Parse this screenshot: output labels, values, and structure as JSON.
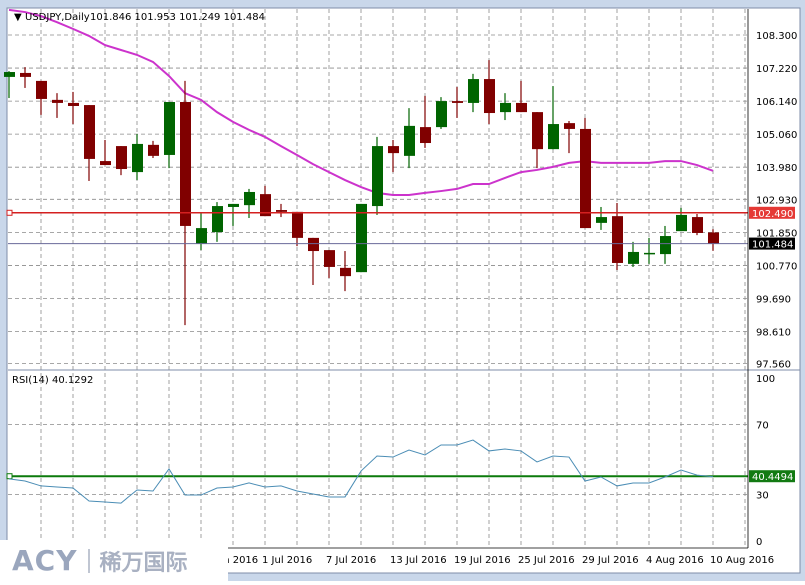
{
  "header": {
    "symbol": "USDJPY,Daily",
    "ohlc": "101.846 101.953 101.249 101.484"
  },
  "rsi_label": "RSI(14) 40.1292",
  "watermark": {
    "brand": "ACY",
    "chinese": "稀万国际"
  },
  "colors": {
    "bull": "#006400",
    "bear": "#800000",
    "ma": "#cc33cc",
    "hline": "#d42020",
    "price_line": "#6a6a9a",
    "rsi": "#4b8db5",
    "rsi_level": "#0b7a0b"
  },
  "chart_data": [
    {
      "type": "candlestick",
      "symbol": "USDJPY",
      "timeframe": "Daily",
      "ylim": [
        97.2,
        108.6
      ],
      "yticks": [
        "108.300",
        "107.220",
        "106.140",
        "105.060",
        "103.980",
        "102.930",
        "101.850",
        "100.770",
        "99.690",
        "98.610",
        "97.560"
      ],
      "grid": true,
      "dates": [
        "9 Jun",
        "10 Jun",
        "13 Jun",
        "14 Jun",
        "15 Jun",
        "16 Jun",
        "17 Jun",
        "20 Jun",
        "21 Jun",
        "22 Jun",
        "23 Jun",
        "24 Jun",
        "27 Jun",
        "28 Jun",
        "29 Jun",
        "30 Jun",
        "1 Jul",
        "4 Jul",
        "5 Jul",
        "6 Jul",
        "7 Jul",
        "8 Jul",
        "11 Jul",
        "12 Jul",
        "13 Jul",
        "14 Jul",
        "15 Jul",
        "18 Jul",
        "19 Jul",
        "20 Jul",
        "21 Jul",
        "22 Jul",
        "25 Jul",
        "26 Jul",
        "27 Jul",
        "28 Jul",
        "29 Jul",
        "1 Aug",
        "2 Aug",
        "3 Aug",
        "4 Aug",
        "5 Aug",
        "8 Aug",
        "9 Aug",
        "10 Aug"
      ],
      "xtick_labels": [
        {
          "index": 12,
          "label": "27 Jun 2016"
        },
        {
          "index": 16,
          "label": "1 Jul 2016"
        },
        {
          "index": 20,
          "label": "7 Jul 2016"
        },
        {
          "index": 24,
          "label": "13 Jul 2016"
        },
        {
          "index": 28,
          "label": "19 Jul 2016"
        },
        {
          "index": 32,
          "label": "25 Jul 2016"
        },
        {
          "index": 36,
          "label": "29 Jul 2016"
        },
        {
          "index": 40,
          "label": "4 Aug 2016"
        },
        {
          "index": 44,
          "label": "10 Aug 2016"
        }
      ],
      "ohlc": [
        [
          106.93,
          107.12,
          106.24,
          107.09
        ],
        [
          107.06,
          107.25,
          106.57,
          106.93
        ],
        [
          106.8,
          106.8,
          105.69,
          106.21
        ],
        [
          106.18,
          106.4,
          105.59,
          106.08
        ],
        [
          106.08,
          106.44,
          105.39,
          105.98
        ],
        [
          106.01,
          106.01,
          103.53,
          104.25
        ],
        [
          104.18,
          104.87,
          104.05,
          104.05
        ],
        [
          104.67,
          104.67,
          103.72,
          103.92
        ],
        [
          103.82,
          105.06,
          103.56,
          104.74
        ],
        [
          104.71,
          104.84,
          104.28,
          104.35
        ],
        [
          104.38,
          106.11,
          103.95,
          106.11
        ],
        [
          106.11,
          106.8,
          98.82,
          102.06
        ],
        [
          101.47,
          102.48,
          101.27,
          101.99
        ],
        [
          101.86,
          102.84,
          101.54,
          102.71
        ],
        [
          102.68,
          102.78,
          102.06,
          102.78
        ],
        [
          102.74,
          103.27,
          102.32,
          103.17
        ],
        [
          103.1,
          103.37,
          102.38,
          102.38
        ],
        [
          102.58,
          102.78,
          102.35,
          102.52
        ],
        [
          102.52,
          102.52,
          101.4,
          101.67
        ],
        [
          101.67,
          101.67,
          100.13,
          101.24
        ],
        [
          101.27,
          101.27,
          100.36,
          100.72
        ],
        [
          100.69,
          101.24,
          99.93,
          100.42
        ],
        [
          100.55,
          102.78,
          100.55,
          102.78
        ],
        [
          102.71,
          104.97,
          102.42,
          104.67
        ],
        [
          104.67,
          104.87,
          103.82,
          104.44
        ],
        [
          104.35,
          105.91,
          103.95,
          105.33
        ],
        [
          105.29,
          106.31,
          104.61,
          104.77
        ],
        [
          105.29,
          106.27,
          105.23,
          106.14
        ],
        [
          106.14,
          106.6,
          105.59,
          106.08
        ],
        [
          106.08,
          107.03,
          105.78,
          106.86
        ],
        [
          106.86,
          107.48,
          105.39,
          105.75
        ],
        [
          105.78,
          106.4,
          105.52,
          106.08
        ],
        [
          106.08,
          106.8,
          105.78,
          105.78
        ],
        [
          105.78,
          105.78,
          103.95,
          104.57
        ],
        [
          104.57,
          106.63,
          104.57,
          105.39
        ],
        [
          105.42,
          105.49,
          104.44,
          105.23
        ],
        [
          105.23,
          105.59,
          101.99,
          101.99
        ],
        [
          102.16,
          102.68,
          101.93,
          102.35
        ],
        [
          102.38,
          102.81,
          100.62,
          100.85
        ],
        [
          100.82,
          101.54,
          100.72,
          101.21
        ],
        [
          101.14,
          101.67,
          100.82,
          101.18
        ],
        [
          101.14,
          102.06,
          100.82,
          101.73
        ],
        [
          101.89,
          102.65,
          101.89,
          102.42
        ],
        [
          102.35,
          102.45,
          101.76,
          101.83
        ],
        [
          101.846,
          101.953,
          101.249,
          101.484
        ]
      ],
      "moving_average": [
        109.12,
        109.05,
        108.92,
        108.72,
        108.5,
        108.27,
        107.97,
        107.81,
        107.65,
        107.42,
        106.96,
        106.4,
        106.18,
        105.78,
        105.46,
        105.2,
        104.97,
        104.67,
        104.38,
        104.08,
        103.82,
        103.56,
        103.33,
        103.14,
        103.07,
        103.07,
        103.14,
        103.2,
        103.27,
        103.43,
        103.43,
        103.63,
        103.82,
        103.89,
        103.99,
        104.12,
        104.18,
        104.12,
        104.12,
        104.12,
        104.12,
        104.18,
        104.18,
        104.05,
        103.86
      ],
      "horizontal_line": {
        "value": 102.49,
        "label": "102.490"
      },
      "current_price": {
        "value": 101.484,
        "label": "101.484"
      }
    },
    {
      "type": "line",
      "indicator": "RSI(14)",
      "ylim": [
        0,
        100
      ],
      "yticks": [
        "100",
        "70",
        "30",
        "0"
      ],
      "values": [
        38.9,
        37.7,
        34.9,
        34.3,
        33.7,
        26.3,
        25.7,
        25.1,
        32.6,
        32.0,
        44.6,
        29.7,
        29.7,
        33.7,
        34.3,
        36.6,
        34.3,
        34.9,
        32.0,
        30.3,
        28.6,
        28.6,
        43.4,
        52.0,
        51.4,
        55.4,
        52.6,
        58.3,
        58.3,
        61.1,
        54.9,
        56.0,
        54.9,
        48.6,
        52.0,
        51.4,
        37.7,
        40.0,
        34.9,
        36.6,
        36.6,
        40.0,
        44.0,
        41.1,
        40.1292
      ],
      "level": {
        "value": 40.4494,
        "label": "40.4494"
      }
    }
  ]
}
